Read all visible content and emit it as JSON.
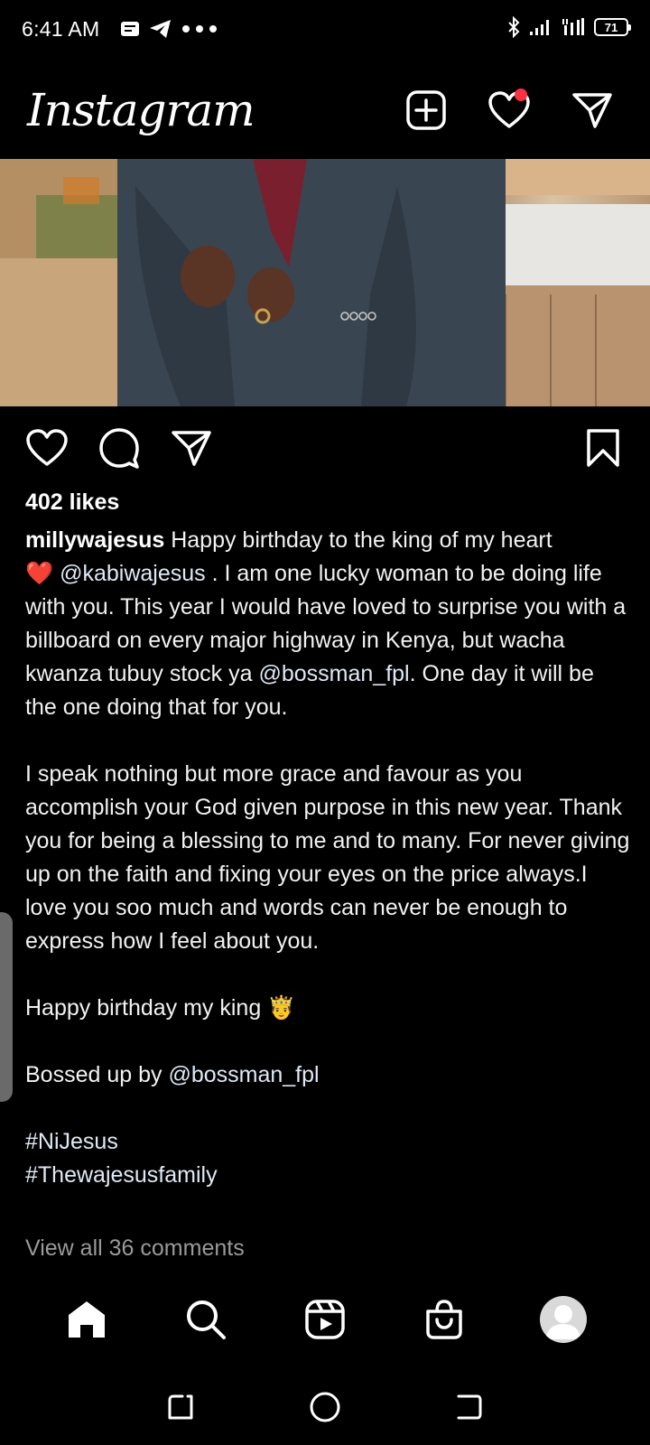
{
  "status": {
    "time": "6:41 AM",
    "battery": "71"
  },
  "header": {
    "logo": "Instagram"
  },
  "post": {
    "likes": "402 likes",
    "username": "millywajesus",
    "caption_p1_a": "Happy birthday to the king of my heart",
    "heart_emoji": "❤️",
    "mention1": "@kabiwajesus",
    "caption_p1_b": " . I am one lucky woman to be doing life with you. This year I would have loved to surprise you with a billboard on every major highway in Kenya, but wacha kwanza tubuy stock ya ",
    "mention2": "@bossman_fpl",
    "caption_p1_c": ". One day it will be the one doing that for you.",
    "caption_p2": "I  speak nothing but more grace and favour as you accomplish your God given purpose in this new year. Thank you for being a blessing to me and to many. For never giving up on the faith and fixing your eyes on the price always.I love you soo much and words can never be enough to express how I feel about you.",
    "caption_p3": "Happy birthday my king 🤴",
    "caption_p4_a": "Bossed up by ",
    "mention3": "@bossman_fpl",
    "hashtag1": "#NiJesus",
    "hashtag2": "#Thewajesusfamily",
    "view_comments": "View all 36 comments"
  },
  "icons": {
    "header": [
      "new-post-icon",
      "heart-icon",
      "direct-message-icon"
    ],
    "actions": [
      "like-icon",
      "comment-icon",
      "share-icon",
      "save-icon"
    ],
    "nav": [
      "home-icon",
      "search-icon",
      "reels-icon",
      "shop-icon",
      "profile-avatar"
    ],
    "system": [
      "recents-icon",
      "home-circle-icon",
      "back-icon"
    ]
  },
  "colors": {
    "background": "#000000",
    "notification": "#ff3040",
    "secondary_text": "#9a9a9a"
  }
}
